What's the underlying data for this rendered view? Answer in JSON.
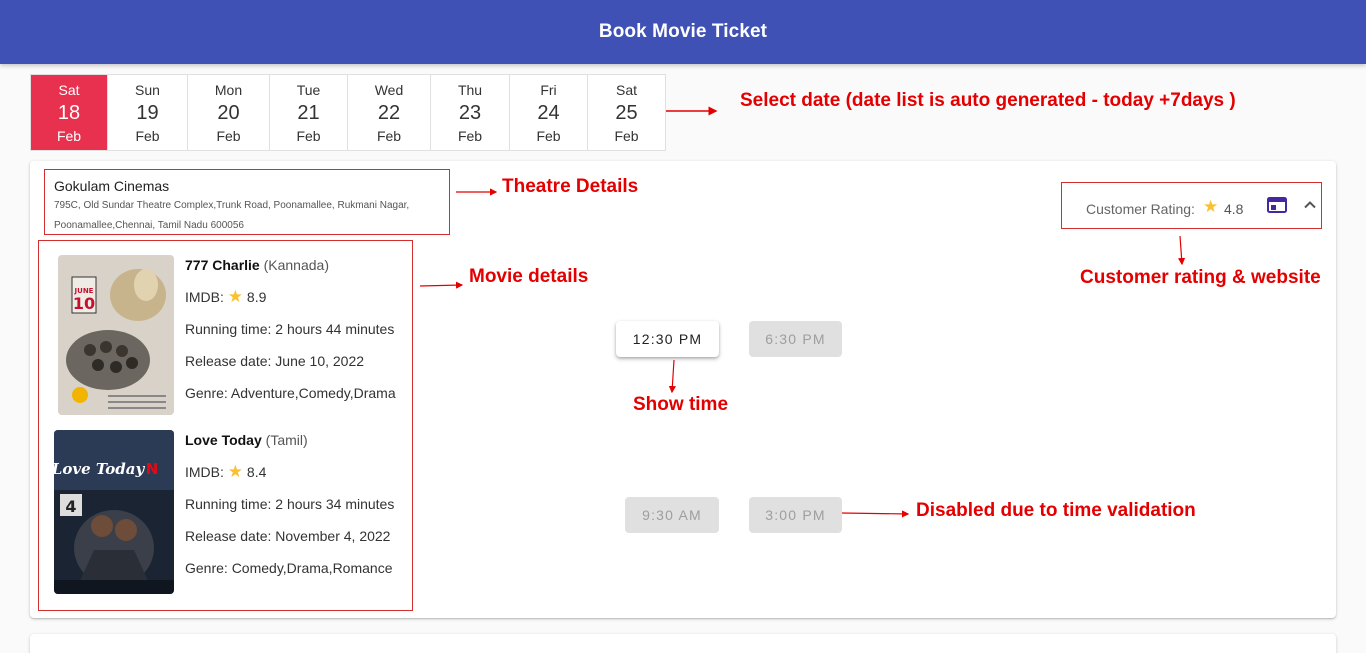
{
  "app": {
    "title": "Book Movie Ticket",
    "header_color": "#3f51b5"
  },
  "dates": [
    {
      "day": "Sat",
      "date": "18",
      "month": "Feb",
      "selected": true
    },
    {
      "day": "Sun",
      "date": "19",
      "month": "Feb",
      "selected": false
    },
    {
      "day": "Mon",
      "date": "20",
      "month": "Feb",
      "selected": false
    },
    {
      "day": "Tue",
      "date": "21",
      "month": "Feb",
      "selected": false
    },
    {
      "day": "Wed",
      "date": "22",
      "month": "Feb",
      "selected": false
    },
    {
      "day": "Thu",
      "date": "23",
      "month": "Feb",
      "selected": false
    },
    {
      "day": "Fri",
      "date": "24",
      "month": "Feb",
      "selected": false
    },
    {
      "day": "Sat",
      "date": "25",
      "month": "Feb",
      "selected": false
    }
  ],
  "theatre": {
    "name": "Gokulam Cinemas",
    "address_line1": "795C, Old Sundar Theatre Complex,Trunk Road, Poonamallee, Rukmani Nagar,",
    "address_line2": "Poonamallee,Chennai, Tamil Nadu 600056",
    "rating_label": "Customer Rating:",
    "rating_icon": "star-icon",
    "rating_value": "4.8"
  },
  "movies": [
    {
      "title": "777 Charlie",
      "language": "(Kannada)",
      "imdb_label": "IMDB:",
      "imdb_value": "8.9",
      "running_time": "Running time: 2 hours 44 minutes",
      "release_date": "Release date: June 10, 2022",
      "genre": "Genre: Adventure,Comedy,Drama",
      "poster_date_label": "JUNE",
      "poster_date_num": "10",
      "showtimes": [
        {
          "time": "12:30 PM",
          "enabled": true
        },
        {
          "time": "6:30 PM",
          "enabled": false
        }
      ]
    },
    {
      "title": "Love Today",
      "language": "(Tamil)",
      "imdb_label": "IMDB:",
      "imdb_value": "8.4",
      "running_time": "Running time: 2 hours 34 minutes",
      "release_date": "Release date: November 4, 2022",
      "genre": "Genre: Comedy,Drama,Romance",
      "poster_title": "Love Today",
      "showtimes": [
        {
          "time": "9:30 AM",
          "enabled": false
        },
        {
          "time": "3:00 PM",
          "enabled": false
        }
      ]
    }
  ],
  "annotations": {
    "select_date": "Select date (date list is auto generated - today +7days )",
    "theatre_details": "Theatre Details",
    "movie_details": "Movie details",
    "customer_rating": "Customer rating & website",
    "show_time": "Show time",
    "disabled": "Disabled due to time validation"
  },
  "colors": {
    "accent": "#e8304f",
    "annotation": "#e40000",
    "star": "#fbc02d"
  }
}
